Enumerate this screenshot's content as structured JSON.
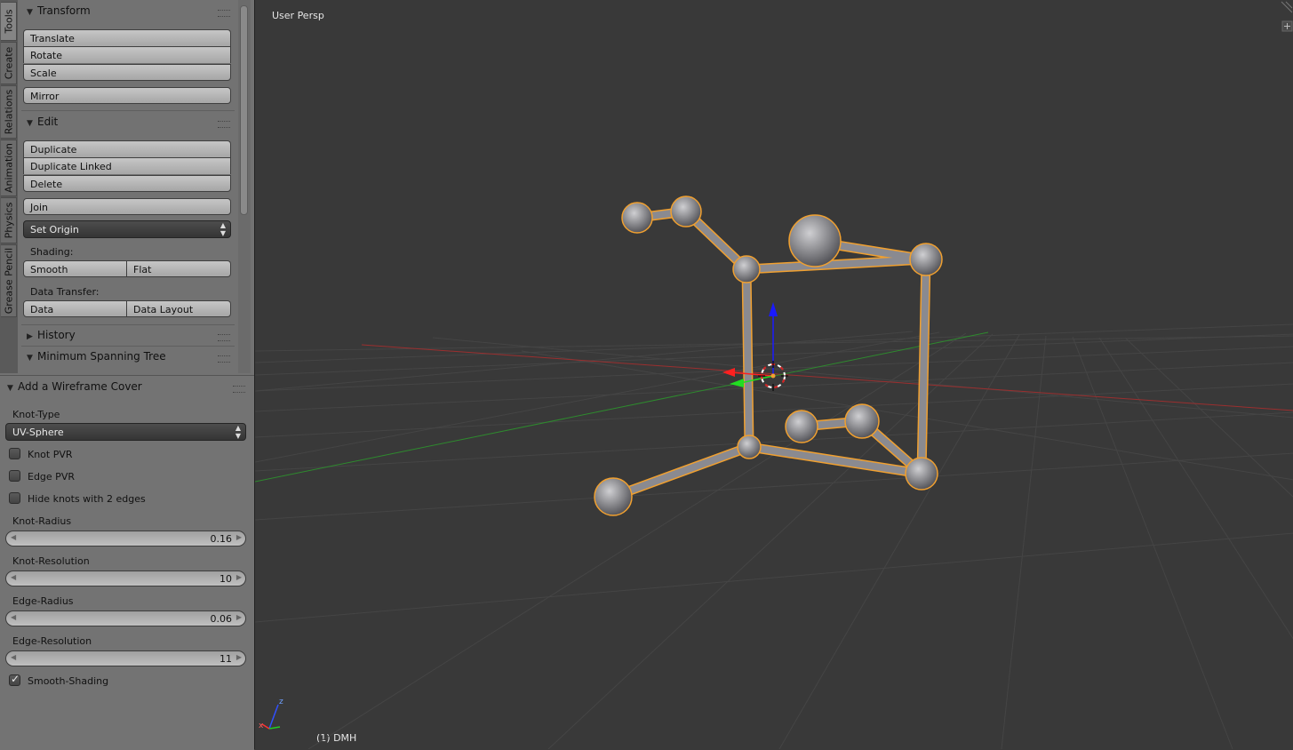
{
  "tabs": [
    "Tools",
    "Create",
    "Relations",
    "Animation",
    "Physics",
    "Grease Pencil"
  ],
  "tools": {
    "transform": {
      "title": "Transform",
      "buttons": [
        "Translate",
        "Rotate",
        "Scale"
      ],
      "mirror": "Mirror"
    },
    "edit": {
      "title": "Edit",
      "buttons": [
        "Duplicate",
        "Duplicate Linked",
        "Delete"
      ],
      "join": "Join",
      "set_origin": "Set Origin",
      "shading_label": "Shading:",
      "smooth": "Smooth",
      "flat": "Flat",
      "data_transfer_label": "Data Transfer:",
      "data": "Data",
      "data_layout": "Data Layout"
    },
    "history": "History",
    "mst": "Minimum Spanning Tree"
  },
  "operator": {
    "title": "Add a Wireframe Cover",
    "knot_type_label": "Knot-Type",
    "knot_type_value": "UV-Sphere",
    "knot_pvr": "Knot PVR",
    "edge_pvr": "Edge PVR",
    "hide_knots": "Hide knots with 2 edges",
    "knot_radius_label": "Knot-Radius",
    "knot_radius": "0.16",
    "knot_resolution_label": "Knot-Resolution",
    "knot_resolution": "10",
    "edge_radius_label": "Edge-Radius",
    "edge_radius": "0.06",
    "edge_resolution_label": "Edge-Resolution",
    "edge_resolution": "11",
    "smooth_shading": "Smooth-Shading",
    "checkbox_states": {
      "knot_pvr": false,
      "edge_pvr": false,
      "hide_knots": false,
      "smooth_shading": true
    }
  },
  "viewport": {
    "view_name": "User Persp",
    "object_info": "(1) DMH",
    "axis_labels": {
      "z": "z",
      "x": "x"
    },
    "colors": {
      "selection_outline": "#f0a030",
      "x_axis": "#b03030",
      "y_axis": "#2e9a2e",
      "z_axis": "#1a1aff"
    }
  }
}
